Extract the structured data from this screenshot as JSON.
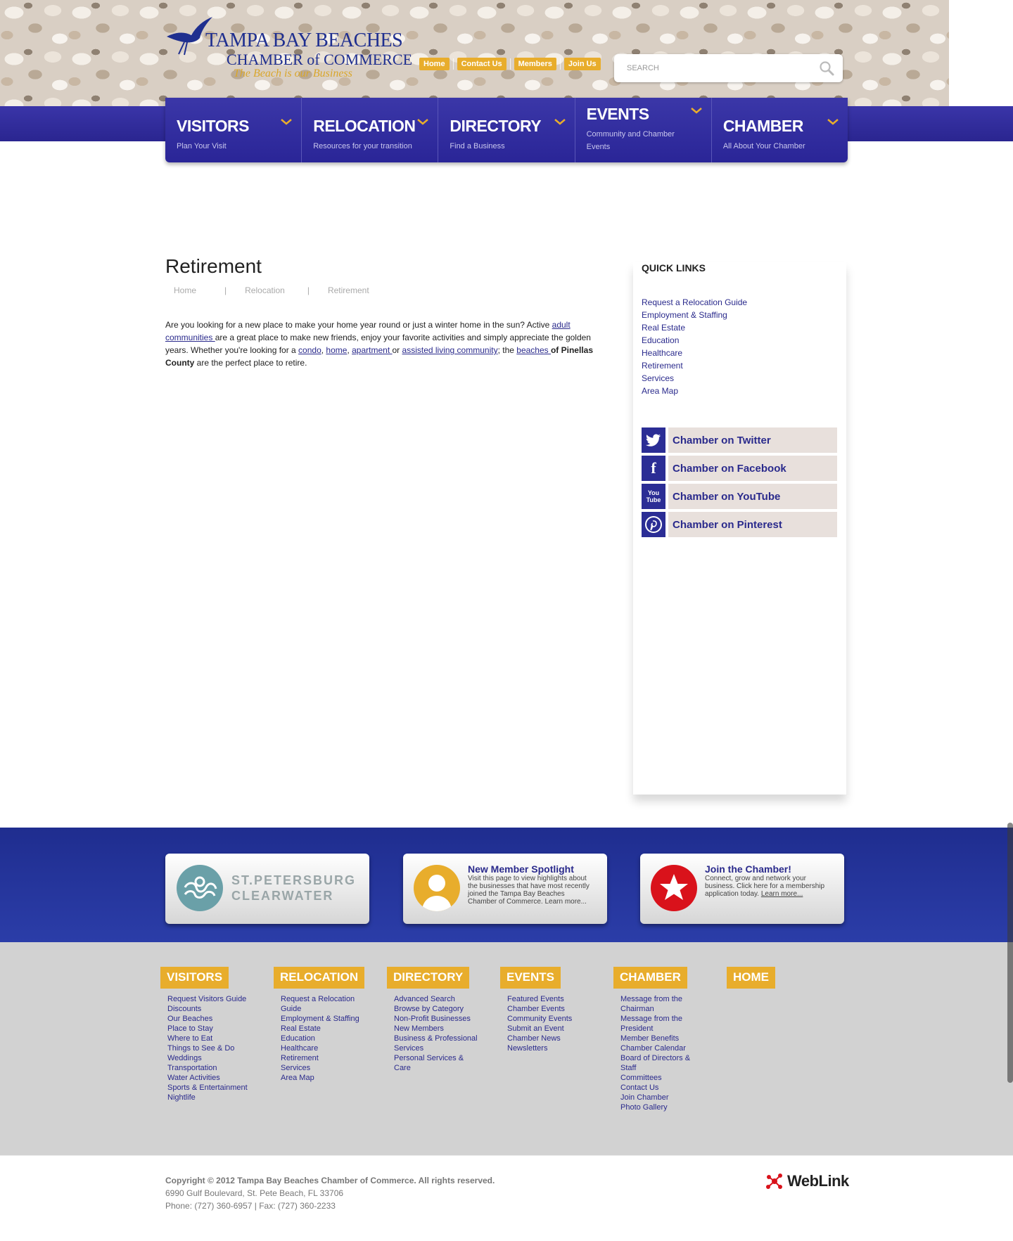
{
  "header": {
    "logo_line1": "TAMPA BAY BEACHES",
    "logo_line2": "CHAMBER of COMMERCE",
    "logo_line3": "The Beach is our Business",
    "top_links": [
      "Home",
      "Contact Us",
      "Members",
      "Join Us"
    ],
    "search_placeholder": "SEARCH"
  },
  "nav": [
    {
      "title": "VISITORS",
      "sub": "Plan Your Visit"
    },
    {
      "title": "RELOCATION",
      "sub": "Resources for your transition"
    },
    {
      "title": "DIRECTORY",
      "sub": "Find a Business"
    },
    {
      "title": "EVENTS",
      "sub": "Community and Chamber Events"
    },
    {
      "title": "CHAMBER",
      "sub": "All About Your Chamber"
    }
  ],
  "main": {
    "title": "Retirement",
    "breadcrumb": [
      "Home",
      "Relocation",
      "Retirement"
    ],
    "text_1": "Are you looking for a new place to make your home year round or just a winter home in the sun?  Active ",
    "link_adult": "adult communities ",
    "text_2": "are a great place to make new friends, enjoy your favorite activities and simply appreciate the golden years. Whether you're looking for a ",
    "link_condo": "condo",
    "text_3": ", ",
    "link_home": "home",
    "text_4": ", ",
    "link_apartment": "apartment ",
    "text_5": "or ",
    "link_assisted": "assisted living community",
    "text_6": "; the ",
    "link_beaches": "beaches ",
    "text_7": "of ",
    "bold_text": "Pinellas County",
    "text_8": " are the perfect place to retire."
  },
  "sidebar": {
    "title": "QUICK LINKS",
    "links": [
      "Request a Relocation Guide",
      "Employment & Staffing",
      "Real Estate",
      "Education",
      "Healthcare",
      "Retirement",
      "Services",
      "Area Map"
    ],
    "social": [
      {
        "label": "Chamber on Twitter",
        "icon": "twitter-icon"
      },
      {
        "label": "Chamber on Facebook",
        "icon": "facebook-icon"
      },
      {
        "label": "Chamber on YouTube",
        "icon": "youtube-icon"
      },
      {
        "label": "Chamber on Pinterest",
        "icon": "pinterest-icon"
      }
    ],
    "youtube_glyph_1": "You",
    "youtube_glyph_2": "Tube"
  },
  "cards": {
    "spc_line1": "ST.PETERSBURG",
    "spc_line2": "CLEARWATER",
    "spotlight_title": "New Member Spotlight",
    "spotlight_text": "Visit this page to view highlights about the businesses that have most recently joined the Tampa Bay Beaches Chamber of Commerce.",
    "spotlight_more": "Learn more...",
    "join_title": "Join the Chamber!",
    "join_text": "Connect, grow and network your business. Click here for a membership application today.",
    "join_more": "Learn more..."
  },
  "footer": {
    "columns": [
      {
        "head": "VISITORS",
        "items": [
          "Request Visitors Guide",
          "Discounts",
          "Our Beaches",
          "Place to Stay",
          "Where to Eat",
          "Things to See & Do",
          "Weddings",
          "Transportation",
          "Water Activities",
          "Sports & Entertainment",
          "Nightlife"
        ]
      },
      {
        "head": "RELOCATION",
        "items": [
          "Request a Relocation Guide",
          "Employment & Staffing",
          "Real Estate",
          "Education",
          "Healthcare",
          "Retirement",
          "Services",
          "Area Map"
        ]
      },
      {
        "head": "DIRECTORY",
        "items": [
          "Advanced Search",
          "Browse by Category",
          "Non-Profit Businesses",
          "New Members",
          "Business & Professional Services",
          "Personal Services & Care"
        ]
      },
      {
        "head": "EVENTS",
        "items": [
          "Featured Events",
          "Chamber Events",
          "Community Events",
          "Submit an Event",
          "Chamber News",
          "Newsletters"
        ]
      },
      {
        "head": "CHAMBER",
        "items": [
          "Message from the Chairman",
          "Message from the President",
          "Member Benefits",
          "Chamber Calendar",
          "Board of Directors & Staff",
          "Committees",
          "Contact Us",
          "Join Chamber",
          "Photo Gallery"
        ]
      },
      {
        "head": "HOME",
        "items": []
      }
    ],
    "copyright": "Copyright © 2012 Tampa Bay Beaches Chamber of Commerce.  All rights reserved.",
    "address": "6990 Gulf Boulevard, St. Pete Beach, FL 33706",
    "phone": "Phone: (727) 360-6957 | Fax: (727) 360-2233",
    "weblink": "WebLink"
  },
  "colors": {
    "brand_blue": "#2a2590",
    "accent_gold": "#e8ad2c",
    "link": "#2a2a8c"
  }
}
